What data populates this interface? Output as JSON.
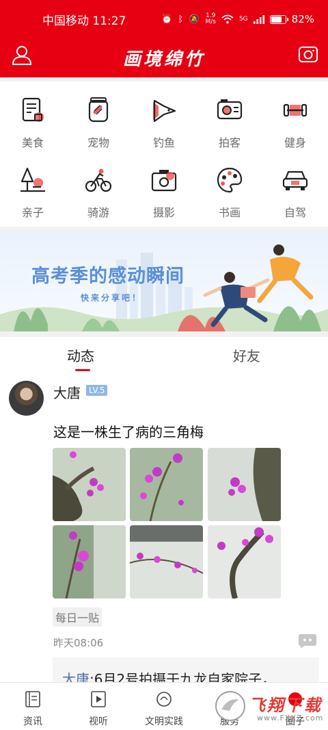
{
  "status_bar": {
    "carrier_time": "中国移动 11:27",
    "net_speed": "1.9",
    "net_unit": "M/s",
    "signal_label": "5G",
    "battery": "82%",
    "battery_level": 0.82
  },
  "header": {
    "brand": "画境绵竹"
  },
  "categories": [
    {
      "label": "美食",
      "icon": "food-menu-icon"
    },
    {
      "label": "宠物",
      "icon": "pet-food-icon"
    },
    {
      "label": "钓鱼",
      "icon": "fish-icon"
    },
    {
      "label": "拍客",
      "icon": "camera-card-icon"
    },
    {
      "label": "健身",
      "icon": "dumbbell-icon"
    },
    {
      "label": "亲子",
      "icon": "tree-swing-icon"
    },
    {
      "label": "骑游",
      "icon": "cyclist-icon"
    },
    {
      "label": "摄影",
      "icon": "camera-icon"
    },
    {
      "label": "书画",
      "icon": "palette-icon"
    },
    {
      "label": "自驾",
      "icon": "car-icon"
    }
  ],
  "banner": {
    "title": "高考季的感动瞬间",
    "subtitle": "快来分享吧！"
  },
  "tabs": [
    {
      "label": "动态",
      "active": true
    },
    {
      "label": "好友",
      "active": false
    }
  ],
  "post": {
    "author": "大唐",
    "level": "LV.5",
    "text": "这是一株生了病的三角梅",
    "tag": "每日一贴",
    "time": "昨天08:06",
    "comment_author": "大唐",
    "comment_text": ":6月2号拍摄于九龙自家院子，"
  },
  "bottom_nav": [
    {
      "label": "资讯",
      "icon": "news-icon"
    },
    {
      "label": "视听",
      "icon": "play-icon"
    },
    {
      "label": "文明实践",
      "icon": "civility-icon"
    },
    {
      "label": "服务",
      "icon": "service-icon"
    },
    {
      "label": "圈子",
      "icon": "circle-icon"
    }
  ],
  "watermark": {
    "text": "飞翔下载",
    "url": "www.FXXZ.com"
  },
  "colors": {
    "brand_red": "#e60012",
    "accent_pink": "#f05a5a",
    "banner_blue": "#5b8fd6",
    "level_blue": "#8fb6e8",
    "comment_link": "#4a6ea9"
  }
}
